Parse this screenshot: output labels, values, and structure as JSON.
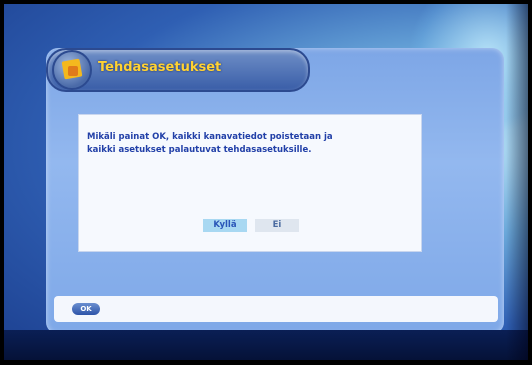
{
  "window": {
    "title": "Tehdasasetukset",
    "title_icon": "factory-settings-icon"
  },
  "dialog": {
    "message_line1": "Mikäli painat OK, kaikki kanavatiedot poistetaan ja",
    "message_line2": "kaikki asetukset palautuvat tehdasasetuksille.",
    "yes_label": "Kyllä",
    "no_label": "Ei",
    "selected": "yes"
  },
  "footer": {
    "ok_label": "OK"
  },
  "colors": {
    "title_text": "#ffd232",
    "message_text": "#2240a8",
    "selected_button": "#a8d8f2",
    "panel": "#8db2ec"
  }
}
